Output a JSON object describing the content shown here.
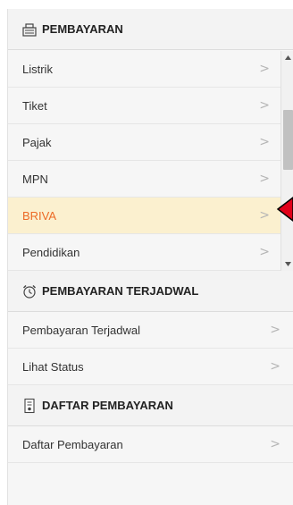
{
  "sections": {
    "pembayaran": {
      "title": "PEMBAYARAN",
      "icon": "payment-register-icon",
      "items": [
        {
          "label": "Listrik"
        },
        {
          "label": "Tiket"
        },
        {
          "label": "Pajak"
        },
        {
          "label": "MPN"
        },
        {
          "label": "BRIVA",
          "active": true
        },
        {
          "label": "Pendidikan"
        }
      ]
    },
    "terjadwal": {
      "title": "PEMBAYARAN TERJADWAL",
      "icon": "alarm-clock-icon",
      "items": [
        {
          "label": "Pembayaran Terjadwal"
        },
        {
          "label": "Lihat Status"
        }
      ]
    },
    "daftar": {
      "title": "DAFTAR PEMBAYARAN",
      "icon": "document-list-icon",
      "items": [
        {
          "label": "Daftar Pembayaran"
        }
      ]
    }
  },
  "chevron": ">",
  "colors": {
    "active_text": "#ec6a26",
    "active_bg": "#fbf0cf",
    "marker": "#e0001a"
  }
}
